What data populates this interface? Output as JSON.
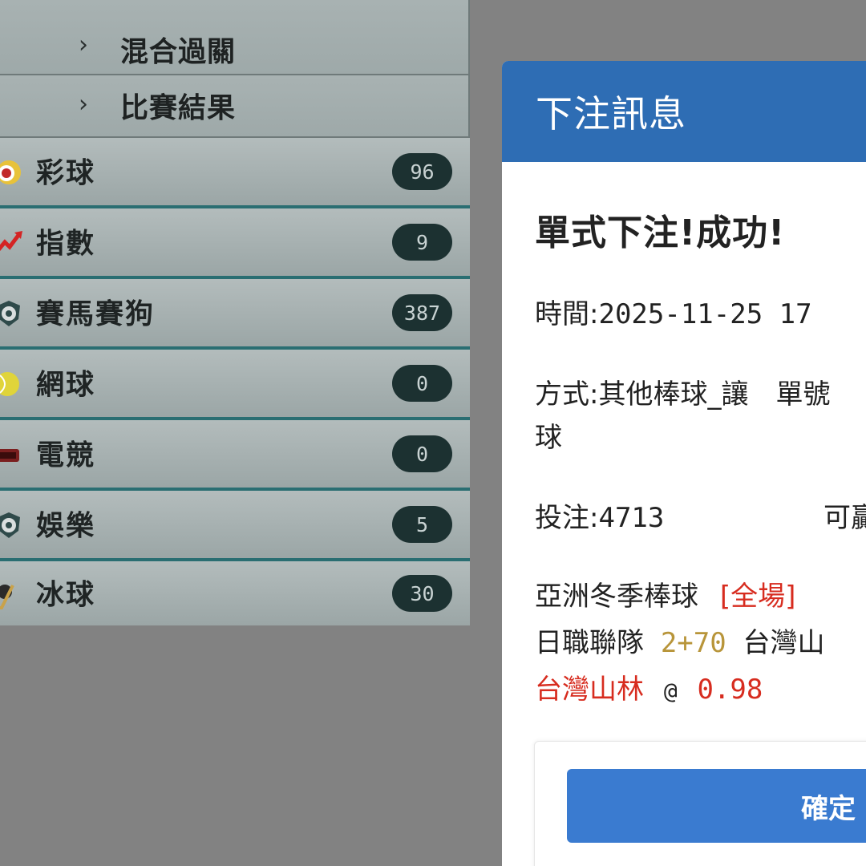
{
  "menu": {
    "sub_items": [
      {
        "label": "混合過關"
      },
      {
        "label": "比賽結果"
      }
    ],
    "categories": [
      {
        "label": "彩球",
        "count": "96",
        "icon": "lottery-ball-icon"
      },
      {
        "label": "指數",
        "count": "9",
        "icon": "trend-arrow-icon"
      },
      {
        "label": "賽馬賽狗",
        "count": "387",
        "icon": "shield-ball-icon"
      },
      {
        "label": "網球",
        "count": "0",
        "icon": "tennis-ball-icon"
      },
      {
        "label": "電競",
        "count": "0",
        "icon": "esports-icon"
      },
      {
        "label": "娛樂",
        "count": "5",
        "icon": "shield-ball-icon"
      },
      {
        "label": "冰球",
        "count": "30",
        "icon": "hockey-stick-icon"
      }
    ]
  },
  "modal": {
    "title": "下注訊息",
    "success_text": "單式下注!成功!",
    "time_label": "時間:",
    "time_value": "2025-11-25 17",
    "method_label": "方式:",
    "method_value": "其他棒球_讓　單號",
    "method_wrap": "球",
    "stake_label": "投注:",
    "stake_value": "4713",
    "winnable_label": "可贏",
    "league": "亞洲冬季棒球",
    "period": "[全場]",
    "home_team": "日職聯隊",
    "handicap": "2+70",
    "away_team": "台灣山",
    "pick": "台灣山林",
    "at": "@",
    "odds": "0.98",
    "confirm_label": "確定"
  },
  "colors": {
    "header_blue": "#2e6db4",
    "button_blue": "#3a7bd0",
    "accent_red": "#d72c1f",
    "handicap_gold": "#b8953a",
    "count_badge": "#1c3131"
  }
}
